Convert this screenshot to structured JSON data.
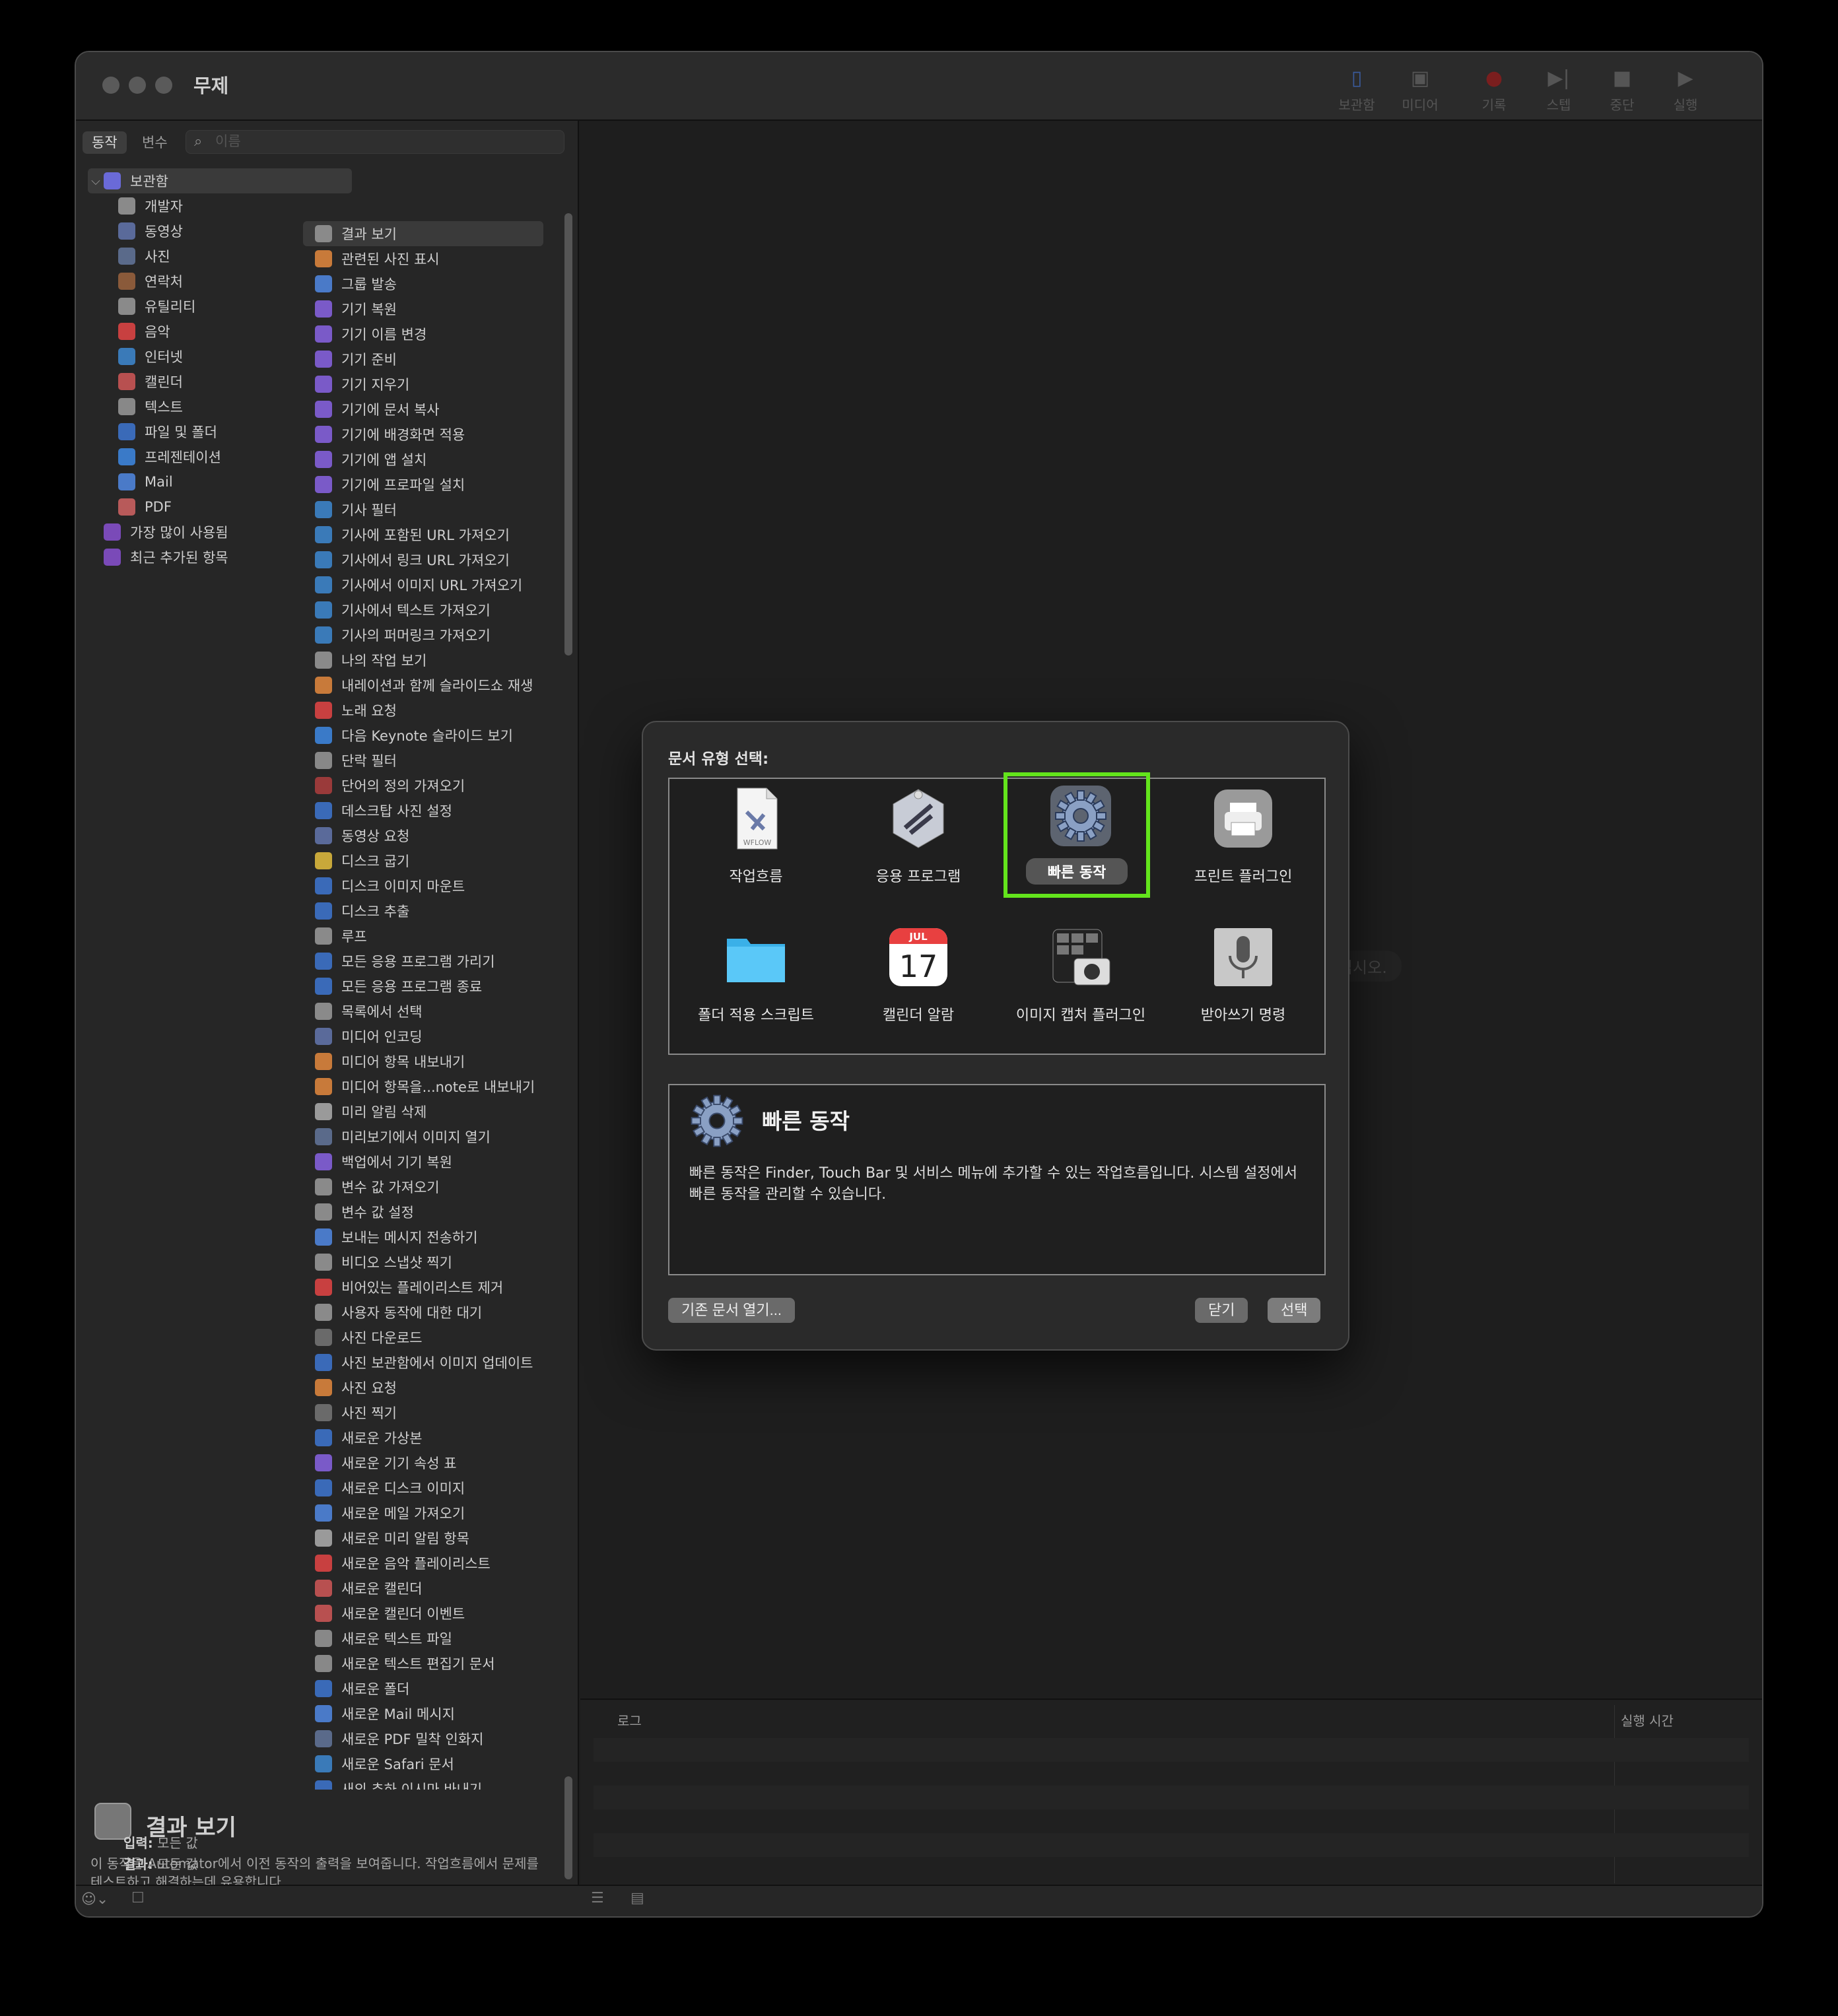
{
  "window": {
    "title": "무제"
  },
  "toolbar": [
    {
      "id": "library",
      "label": "보관함",
      "icon": "library-icon",
      "glyph": "▯",
      "color": "#3a5a9a"
    },
    {
      "id": "media",
      "label": "미디어",
      "icon": "media-icon",
      "glyph": "▣",
      "color": "#555555"
    },
    {
      "id": "record",
      "label": "기록",
      "icon": "record-icon",
      "glyph": "●",
      "color": "#7a1e1e"
    },
    {
      "id": "step",
      "label": "스텝",
      "icon": "step-icon",
      "glyph": "▶|",
      "color": "#555555"
    },
    {
      "id": "stop",
      "label": "중단",
      "icon": "stop-icon",
      "glyph": "■",
      "color": "#555555"
    },
    {
      "id": "run",
      "label": "실행",
      "icon": "run-icon",
      "glyph": "▶",
      "color": "#555555"
    }
  ],
  "library": {
    "tabs": [
      {
        "label": "동작",
        "active": true
      },
      {
        "label": "변수",
        "active": false
      }
    ],
    "search_placeholder": "이름",
    "categories": [
      {
        "label": "보관함",
        "icon": "library-folder-icon",
        "color": "#6a6ad8",
        "chev": "⌵",
        "indent": 0,
        "selected": true
      },
      {
        "label": "개발자",
        "icon": "developer-icon",
        "color": "#8a8a8a",
        "indent": 1
      },
      {
        "label": "동영상",
        "icon": "movie-icon",
        "color": "#5a6a9a",
        "indent": 1
      },
      {
        "label": "사진",
        "icon": "photos-icon",
        "color": "#5a6a8a",
        "indent": 1
      },
      {
        "label": "연락처",
        "icon": "contacts-icon",
        "color": "#8a5a3a",
        "indent": 1
      },
      {
        "label": "유틸리티",
        "icon": "utilities-icon",
        "color": "#8a8a8a",
        "indent": 1
      },
      {
        "label": "음악",
        "icon": "music-icon",
        "color": "#c84040",
        "indent": 1
      },
      {
        "label": "인터넷",
        "icon": "internet-icon",
        "color": "#3a7ab8",
        "indent": 1
      },
      {
        "label": "캘린더",
        "icon": "calendar-icon",
        "color": "#b85050",
        "indent": 1
      },
      {
        "label": "텍스트",
        "icon": "text-icon",
        "color": "#888888",
        "indent": 1
      },
      {
        "label": "파일 및 폴더",
        "icon": "files-folders-icon",
        "color": "#3a6ab8",
        "indent": 1
      },
      {
        "label": "프레젠테이션",
        "icon": "presentation-icon",
        "color": "#3a7ac8",
        "indent": 1
      },
      {
        "label": "Mail",
        "icon": "mail-icon",
        "color": "#4a7ac8",
        "indent": 1
      },
      {
        "label": "PDF",
        "icon": "pdf-icon",
        "color": "#b85a5a",
        "indent": 1
      },
      {
        "label": "가장 많이 사용됨",
        "icon": "smart-folder-icon",
        "color": "#7a4ab8",
        "indent": 0
      },
      {
        "label": "최근 추가된 항목",
        "icon": "smart-folder-icon",
        "color": "#7a4ab8",
        "indent": 0
      }
    ],
    "actions": [
      {
        "label": "결과 보기",
        "color": "#8a8a8a",
        "selected": true
      },
      {
        "label": "관련된 사진 표시",
        "color": "#c87a3a"
      },
      {
        "label": "그룹 발송",
        "color": "#4a7ac8"
      },
      {
        "label": "기기 복원",
        "color": "#7a5ac8"
      },
      {
        "label": "기기 이름 변경",
        "color": "#7a5ac8"
      },
      {
        "label": "기기 준비",
        "color": "#7a5ac8"
      },
      {
        "label": "기기 지우기",
        "color": "#7a5ac8"
      },
      {
        "label": "기기에 문서 복사",
        "color": "#7a5ac8"
      },
      {
        "label": "기기에 배경화면 적용",
        "color": "#7a5ac8"
      },
      {
        "label": "기기에 앱 설치",
        "color": "#7a5ac8"
      },
      {
        "label": "기기에 프로파일 설치",
        "color": "#7a5ac8"
      },
      {
        "label": "기사 필터",
        "color": "#3a7ab8"
      },
      {
        "label": "기사에 포함된 URL 가져오기",
        "color": "#3a7ab8"
      },
      {
        "label": "기사에서 링크 URL 가져오기",
        "color": "#3a7ab8"
      },
      {
        "label": "기사에서 이미지 URL 가져오기",
        "color": "#3a7ab8"
      },
      {
        "label": "기사에서 텍스트 가져오기",
        "color": "#3a7ab8"
      },
      {
        "label": "기사의 퍼머링크 가져오기",
        "color": "#3a7ab8"
      },
      {
        "label": "나의 작업 보기",
        "color": "#8a8a8a"
      },
      {
        "label": "내레이션과 함께 슬라이드쇼 재생",
        "color": "#c87a3a"
      },
      {
        "label": "노래 요청",
        "color": "#c84040"
      },
      {
        "label": "다음 Keynote 슬라이드 보기",
        "color": "#3a7ac8"
      },
      {
        "label": "단락 필터",
        "color": "#888888"
      },
      {
        "label": "단어의 정의 가져오기",
        "color": "#9a3a3a"
      },
      {
        "label": "데스크탑 사진 설정",
        "color": "#3a6ab8"
      },
      {
        "label": "동영상 요청",
        "color": "#5a6a9a"
      },
      {
        "label": "디스크 굽기",
        "color": "#c8a83a"
      },
      {
        "label": "디스크 이미지 마운트",
        "color": "#3a6ab8"
      },
      {
        "label": "디스크 추출",
        "color": "#3a6ab8"
      },
      {
        "label": "루프",
        "color": "#8a8a8a"
      },
      {
        "label": "모든 응용 프로그램 가리기",
        "color": "#3a6ab8"
      },
      {
        "label": "모든 응용 프로그램 종료",
        "color": "#3a6ab8"
      },
      {
        "label": "목록에서 선택",
        "color": "#8a8a8a"
      },
      {
        "label": "미디어 인코딩",
        "color": "#5a6a9a"
      },
      {
        "label": "미디어 항목 내보내기",
        "color": "#c87a3a"
      },
      {
        "label": "미디어 항목을...note로 내보내기",
        "color": "#c87a3a"
      },
      {
        "label": "미리 알림 삭제",
        "color": "#9a9a9a"
      },
      {
        "label": "미리보기에서 이미지 열기",
        "color": "#5a6a8a"
      },
      {
        "label": "백업에서 기기 복원",
        "color": "#7a5ac8"
      },
      {
        "label": "변수 값 가져오기",
        "color": "#8a8a8a"
      },
      {
        "label": "변수 값 설정",
        "color": "#8a8a8a"
      },
      {
        "label": "보내는 메시지 전송하기",
        "color": "#4a7ac8"
      },
      {
        "label": "비디오 스냅샷 찍기",
        "color": "#8a8a8a"
      },
      {
        "label": "비어있는 플레이리스트 제거",
        "color": "#c84040"
      },
      {
        "label": "사용자 동작에 대한 대기",
        "color": "#8a8a8a"
      },
      {
        "label": "사진 다운로드",
        "color": "#6a6a6a"
      },
      {
        "label": "사진 보관함에서 이미지 업데이트",
        "color": "#3a6ab8"
      },
      {
        "label": "사진 요청",
        "color": "#c87a3a"
      },
      {
        "label": "사진 찍기",
        "color": "#6a6a6a"
      },
      {
        "label": "새로운 가상본",
        "color": "#3a6ab8"
      },
      {
        "label": "새로운 기기 속성 표",
        "color": "#7a5ac8"
      },
      {
        "label": "새로운 디스크 이미지",
        "color": "#3a6ab8"
      },
      {
        "label": "새로운 메일 가져오기",
        "color": "#4a7ac8"
      },
      {
        "label": "새로운 미리 알림 항목",
        "color": "#9a9a9a"
      },
      {
        "label": "새로운 음악 플레이리스트",
        "color": "#c84040"
      },
      {
        "label": "새로운 캘린더",
        "color": "#b85050"
      },
      {
        "label": "새로운 캘린더 이벤트",
        "color": "#b85050"
      },
      {
        "label": "새로운 텍스트 파일",
        "color": "#888888"
      },
      {
        "label": "새로운 텍스트 편집기 문서",
        "color": "#888888"
      },
      {
        "label": "새로운 폴더",
        "color": "#3a6ab8"
      },
      {
        "label": "새로운 Mail 메시지",
        "color": "#4a7ac8"
      },
      {
        "label": "새로운 PDF 밀착 인화지",
        "color": "#5a6a8a"
      },
      {
        "label": "새로운 Safari 문서",
        "color": "#3a7ab8"
      },
      {
        "label": "새의 추하 이시마 바내기",
        "color": "#3a6ab8"
      }
    ],
    "description": {
      "title": "결과 보기",
      "text": "이 동작은 Automator에서 이전 동작의 출력을 보여줍니다. 작업흐름에서 문제를 테스트하고 해결하는데 유용합니다.",
      "input_label": "입력:",
      "input_value": "모든 값",
      "result_label": "결과:",
      "result_value": "모든 값"
    }
  },
  "main": {
    "hint": "를 구축하십시오."
  },
  "log": {
    "col_log": "로그",
    "col_time": "실행 시간"
  },
  "dialog": {
    "prompt": "문서 유형 선택:",
    "types": [
      {
        "label": "작업흐름",
        "icon": "workflow-icon",
        "badge": "WFLOW"
      },
      {
        "label": "응용 프로그램",
        "icon": "application-icon"
      },
      {
        "label": "빠른 동작",
        "icon": "quick-action-gear-icon",
        "selected": true
      },
      {
        "label": "프린트 플러그인",
        "icon": "print-plugin-icon"
      },
      {
        "label": "폴더 적용 스크립트",
        "icon": "folder-action-icon"
      },
      {
        "label": "캘린더 알람",
        "icon": "calendar-alarm-icon",
        "month": "JUL",
        "day": "17"
      },
      {
        "label": "이미지 캡처 플러그인",
        "icon": "image-capture-icon"
      },
      {
        "label": "받아쓰기 명령",
        "icon": "dictation-mic-icon"
      }
    ],
    "detail": {
      "title": "빠른 동작",
      "text": "빠른 동작은 Finder, Touch Bar 및 서비스 메뉴에 추가할 수 있는 작업흐름입니다. 시스템 설정에서 빠른 동작을 관리할 수 있습니다."
    },
    "buttons": {
      "open_existing": "기존 문서 열기...",
      "close": "닫기",
      "choose": "선택"
    }
  },
  "colors": {
    "selection_highlight": "#63e41c",
    "window_bg": "#1e1e1e",
    "dialog_bg": "#2a2a2a"
  }
}
